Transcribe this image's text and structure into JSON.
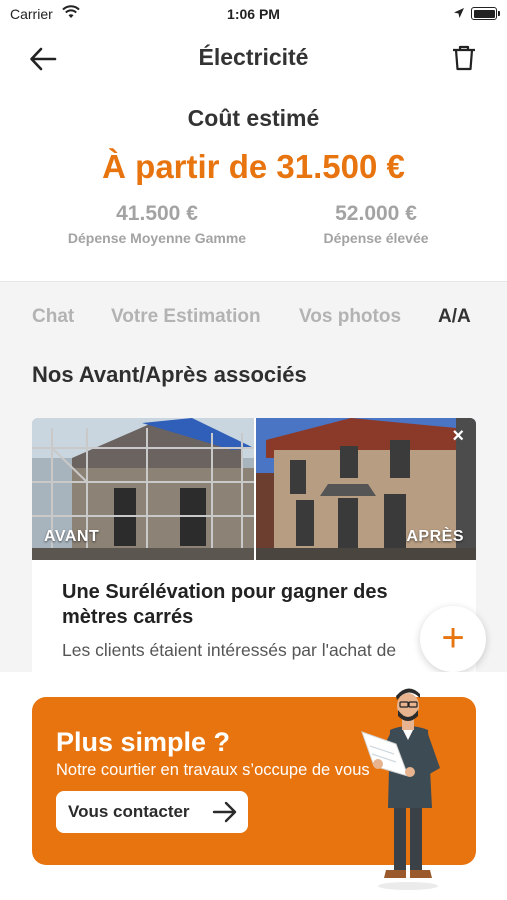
{
  "status_bar": {
    "carrier": "Carrier",
    "time": "1:06 PM"
  },
  "nav": {
    "title": "Électricité"
  },
  "cost": {
    "title": "Coût estimé",
    "main": "À partir de 31.500 €",
    "tiers": [
      {
        "amount": "41.500 €",
        "label": "Dépense Moyenne Gamme"
      },
      {
        "amount": "52.000 €",
        "label": "Dépense élevée"
      }
    ]
  },
  "tabs": [
    {
      "label": "Chat",
      "active": false
    },
    {
      "label": "Votre Estimation",
      "active": false
    },
    {
      "label": "Vos photos",
      "active": false
    },
    {
      "label": "A/A",
      "active": true
    }
  ],
  "section": {
    "title": "Nos Avant/Après associés"
  },
  "card": {
    "before_label": "AVANT",
    "after_label": "APRÈS",
    "close": "×",
    "title": "Une Surélévation pour gagner des mètres carrés",
    "text": "Les clients étaient intéressés par l'achat de"
  },
  "fab": {
    "symbol": "+"
  },
  "banner": {
    "title": "Plus simple ?",
    "subtitle": "Notre courtier en travaux s’occupe de vous",
    "button_label": "Vous contacter"
  },
  "colors": {
    "accent": "#e8740f",
    "text": "#2b2b2b",
    "muted": "#a3a3a3"
  },
  "icons": {
    "back": "arrow-left-icon",
    "trash": "trash-icon",
    "arrow": "arrow-right-icon",
    "wifi": "wifi-icon",
    "location": "location-arrow-icon",
    "battery": "battery-icon"
  }
}
